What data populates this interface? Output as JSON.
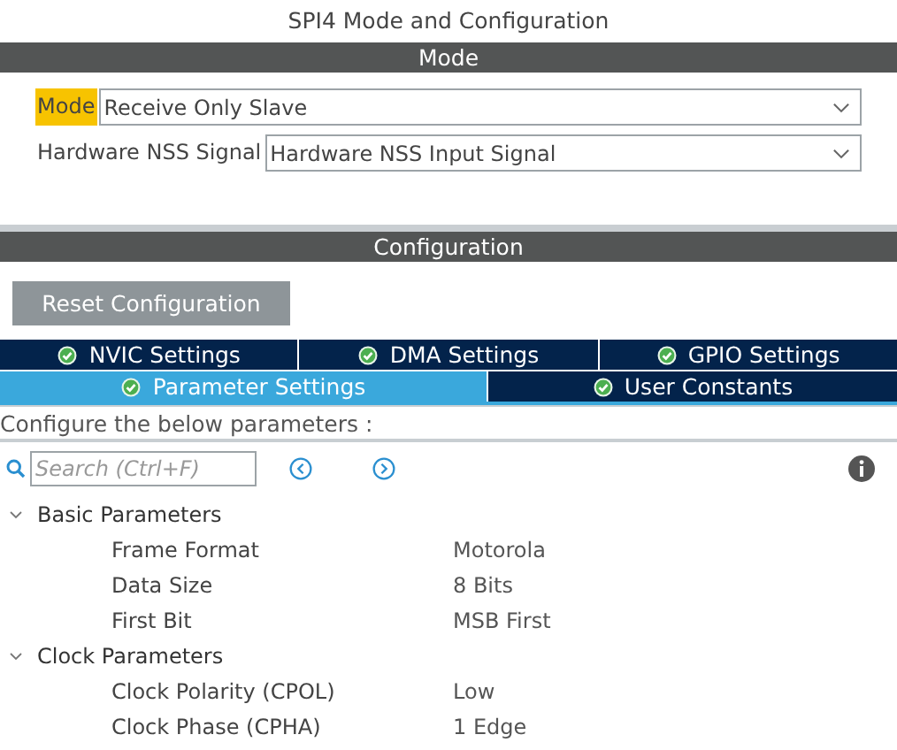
{
  "title": "SPI4 Mode and Configuration",
  "mode_section": {
    "header": "Mode",
    "fields": [
      {
        "label": "Mode",
        "highlighted": true,
        "value": "Receive Only Slave"
      },
      {
        "label": "Hardware NSS Signal",
        "highlighted": false,
        "value": "Hardware NSS Input Signal"
      }
    ]
  },
  "configuration_section": {
    "header": "Configuration",
    "reset_button": "Reset Configuration",
    "tab_rows": [
      [
        {
          "label": "NVIC Settings",
          "selected": false
        },
        {
          "label": "DMA Settings",
          "selected": false
        },
        {
          "label": "GPIO Settings",
          "selected": false
        }
      ],
      [
        {
          "label": "Parameter Settings",
          "selected": true
        },
        {
          "label": "User Constants",
          "selected": false
        }
      ]
    ],
    "instructions": "Configure the below parameters :",
    "search": {
      "placeholder": "Search (Ctrl+F)"
    },
    "tree": [
      {
        "label": "Basic Parameters",
        "expanded": true,
        "children": [
          {
            "name": "Frame Format",
            "value": "Motorola"
          },
          {
            "name": "Data Size",
            "value": "8 Bits"
          },
          {
            "name": "First Bit",
            "value": "MSB First"
          }
        ]
      },
      {
        "label": "Clock Parameters",
        "expanded": true,
        "children": [
          {
            "name": "Clock Polarity (CPOL)",
            "value": "Low"
          },
          {
            "name": "Clock Phase (CPHA)",
            "value": "1 Edge"
          }
        ]
      }
    ]
  }
}
